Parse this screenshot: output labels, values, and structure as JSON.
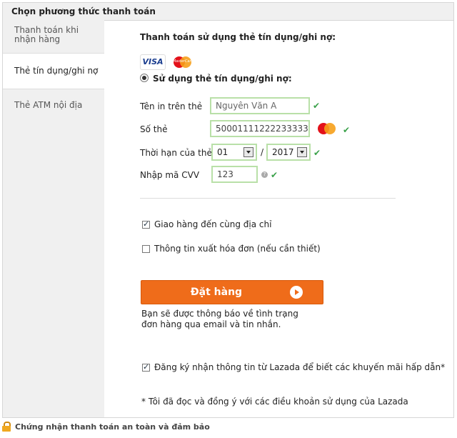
{
  "panel": {
    "title": "Chọn phương thức thanh toán"
  },
  "sidebar": {
    "items": [
      {
        "label": "Thanh toán khi nhận hàng"
      },
      {
        "label": "Thẻ tín dụng/ghi nợ"
      },
      {
        "label": "Thẻ ATM nội địa"
      }
    ],
    "active_index": 1
  },
  "form": {
    "heading": "Thanh toán sử dụng thẻ tín dụng/ghi nợ:",
    "card_logos": {
      "visa": "VISA",
      "mastercard": "MasterCard"
    },
    "radio_label": "Sử dụng thẻ tín dụng/ghi nợ:",
    "name": {
      "label": "Tên in trên thẻ",
      "value": "Nguyên Văn A"
    },
    "number": {
      "label": "Số thẻ",
      "value": "50001111222233333"
    },
    "expiry": {
      "label": "Thời hạn của thẻ",
      "month": "01",
      "separator": "/",
      "year": "2017"
    },
    "cvv": {
      "label": "Nhập mã CVV",
      "value": "123",
      "help": "?"
    },
    "valid_mark": "✔",
    "ship_same": {
      "label": "Giao hàng đến cùng địa chỉ",
      "checked": true
    },
    "invoice": {
      "label": "Thông tin xuất hóa đơn (nếu cần thiết)",
      "checked": false
    },
    "submit_label": "Đặt hàng",
    "notice": "Bạn sẽ được thông báo về tình trạng đơn hàng qua email và tin nhắn.",
    "subscribe": {
      "label": "Đăng ký nhận thông tin từ Lazada để biết các khuyến mãi hấp dẫn*",
      "checked": true
    },
    "terms": "* Tôi đã đọc và đồng ý với các điều khoản sử dụng của Lazada"
  },
  "footer": {
    "text": "Chứng nhận thanh toán an toàn và đảm bảo"
  },
  "colors": {
    "accent": "#ef6c1a",
    "valid": "#3aa14a",
    "field_border": "#b9e0a8"
  }
}
